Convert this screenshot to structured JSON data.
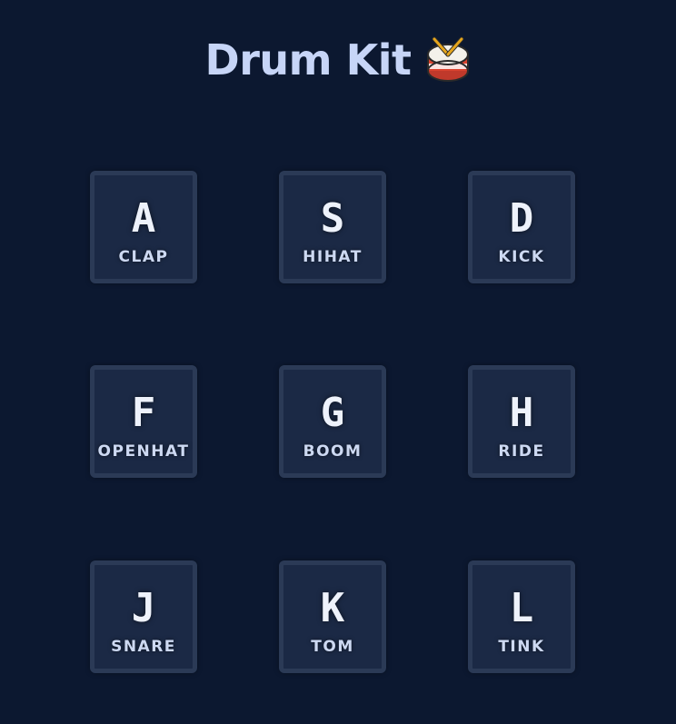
{
  "header": {
    "title": "Drum Kit",
    "icon": "drum-icon"
  },
  "pads": [
    {
      "key": "A",
      "sound": "CLAP"
    },
    {
      "key": "S",
      "sound": "HIHAT"
    },
    {
      "key": "D",
      "sound": "KICK"
    },
    {
      "key": "F",
      "sound": "OPENHAT"
    },
    {
      "key": "G",
      "sound": "BOOM"
    },
    {
      "key": "H",
      "sound": "RIDE"
    },
    {
      "key": "J",
      "sound": "SNARE"
    },
    {
      "key": "K",
      "sound": "TOM"
    },
    {
      "key": "L",
      "sound": "TINK"
    }
  ],
  "colors": {
    "background": "#0c1830",
    "pad_fill": "#1b2945",
    "pad_border": "#2b3a56",
    "title": "#c7d5f7"
  }
}
